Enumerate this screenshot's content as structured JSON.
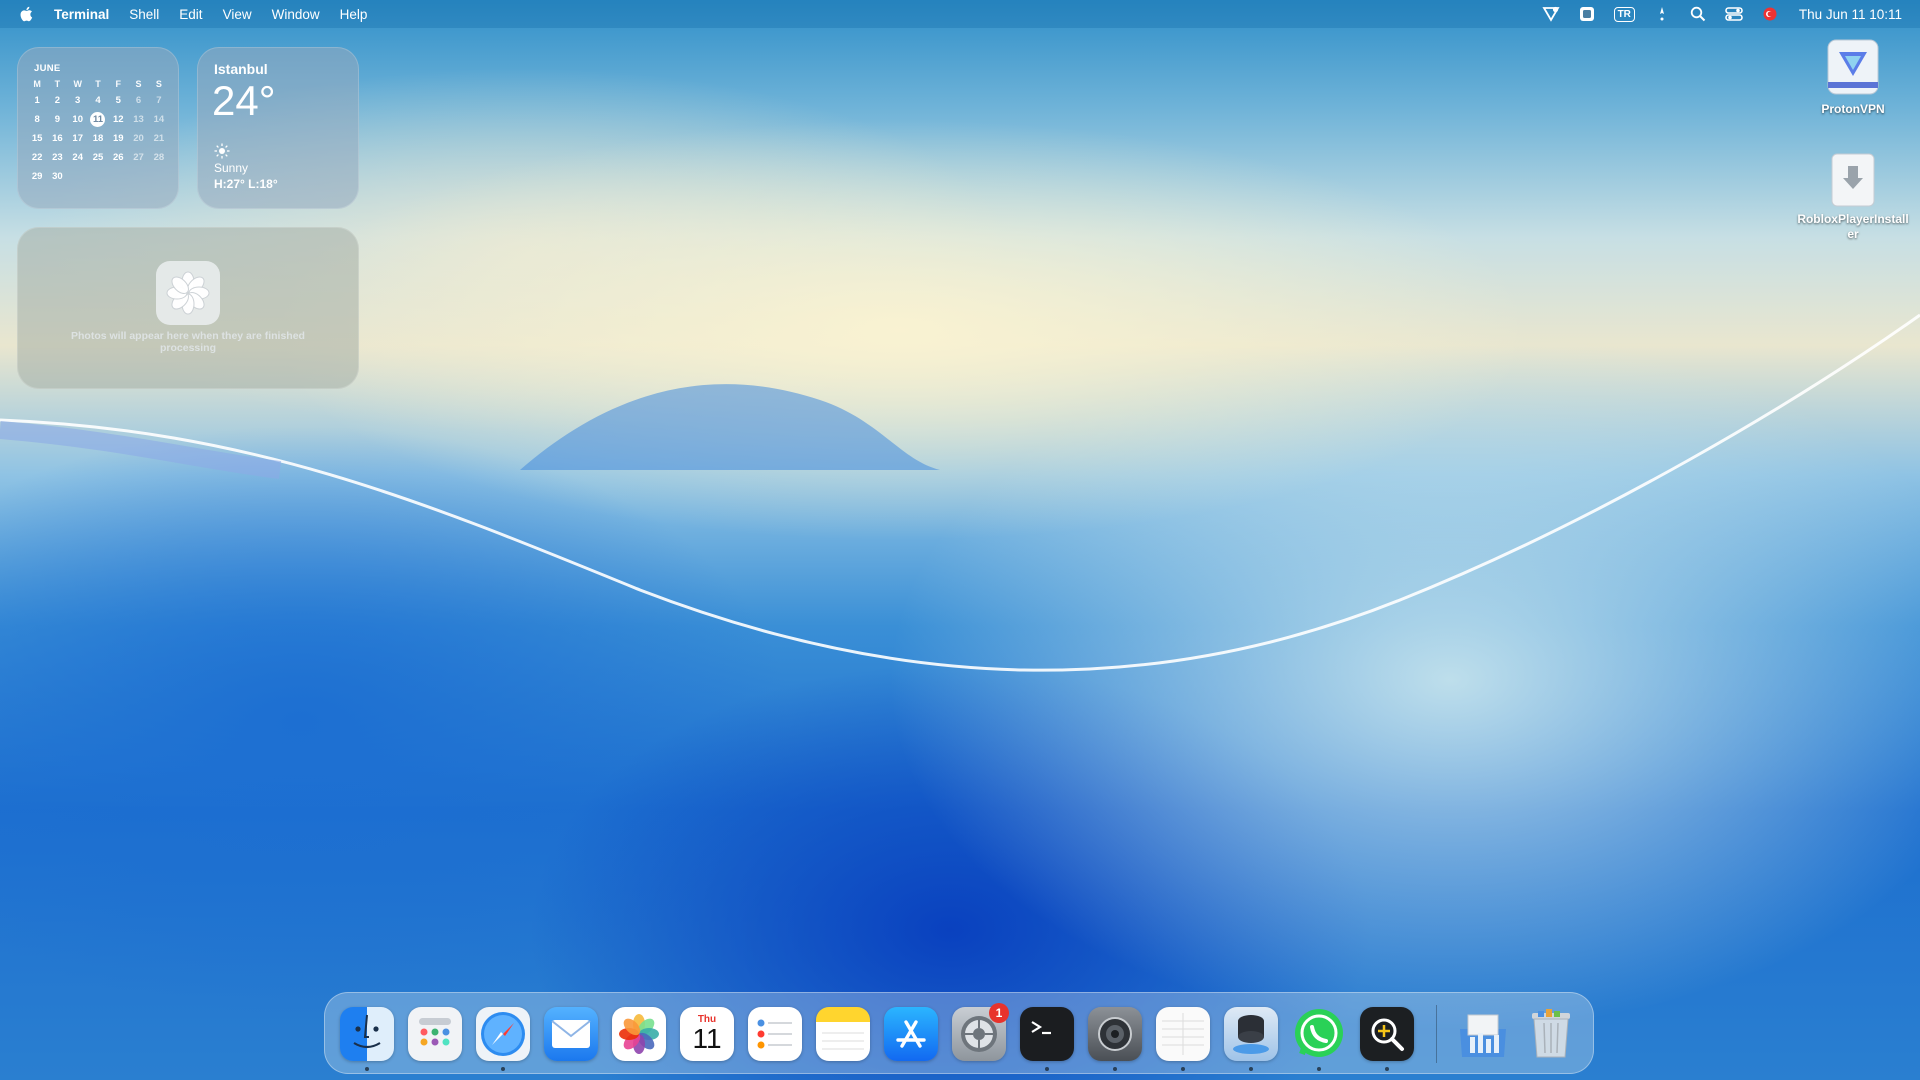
{
  "menubar": {
    "app_name": "Terminal",
    "menus": [
      "Shell",
      "Edit",
      "View",
      "Window",
      "Help"
    ],
    "keyboard_layout": "TR",
    "clock": "Thu Jun 11  10:11",
    "status_icons": [
      "vpn-shield-icon",
      "screen-record-icon",
      "keyboard-layout-icon",
      "alert-icon",
      "search-icon",
      "control-center-icon",
      "flag-icon"
    ]
  },
  "calendar_widget": {
    "month": "JUNE",
    "weekdays": [
      "M",
      "T",
      "W",
      "T",
      "F",
      "S",
      "S"
    ],
    "weeks": [
      [
        "1",
        "2",
        "3",
        "4",
        "5",
        "6",
        "7"
      ],
      [
        "8",
        "9",
        "10",
        "11",
        "12",
        "13",
        "14"
      ],
      [
        "15",
        "16",
        "17",
        "18",
        "19",
        "20",
        "21"
      ],
      [
        "22",
        "23",
        "24",
        "25",
        "26",
        "27",
        "28"
      ],
      [
        "29",
        "30",
        "",
        "",
        "",
        "",
        ""
      ]
    ],
    "today": "11"
  },
  "weather_widget": {
    "city": "Istanbul",
    "temperature": "24°",
    "condition": "Sunny",
    "high_low": "H:27° L:18°"
  },
  "photos_widget": {
    "message": "Photos will appear here when they are finished processing"
  },
  "desktop_icons": {
    "vpn": "ProtonVPN",
    "roblox": "RobloxPlayerInstaller"
  },
  "dock": {
    "apps": [
      "Finder",
      "Launchpad",
      "Safari",
      "Mail",
      "Photos",
      "Calendar",
      "Reminders",
      "Notes",
      "App Store",
      "System Settings",
      "Terminal",
      "Screenshot",
      "TextEdit",
      "Disk Utility",
      "WhatsApp",
      "Magnifier",
      "Downloads",
      "Trash"
    ],
    "calendar_icon": {
      "day_name": "Thu",
      "day_number": "11"
    },
    "settings_badge": "1"
  }
}
